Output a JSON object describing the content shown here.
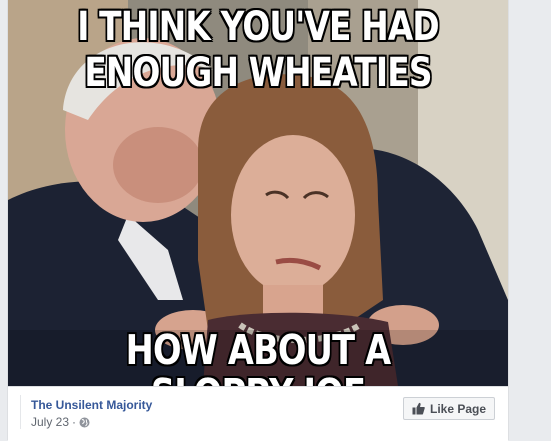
{
  "meme": {
    "top_line_1": "I THINK YOU'VE HAD",
    "top_line_2": "ENOUGH WHEATIES",
    "bottom_line": "HOW ABOUT A SLOPPY JOE"
  },
  "post": {
    "page_name": "The Unsilent Majority",
    "date": "July 23",
    "privacy_icon": "globe-icon",
    "separator": "·"
  },
  "actions": {
    "like_page_label": "Like Page",
    "like_icon": "thumbs-up-icon"
  },
  "colors": {
    "link_blue": "#365899",
    "meta_gray": "#616770",
    "page_bg": "#e9ebee"
  }
}
